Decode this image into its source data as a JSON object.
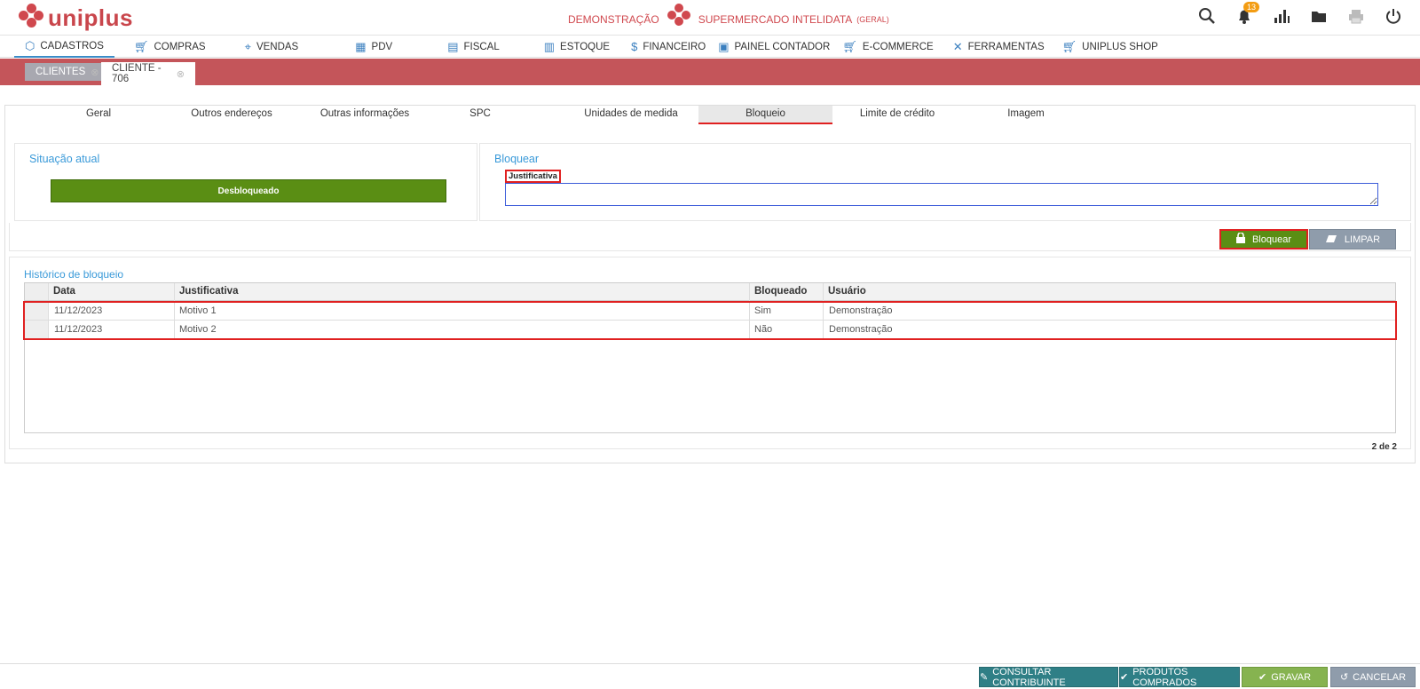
{
  "header": {
    "logo_text": "uniplus",
    "company_prefix": "DEMONSTRAÇÃO",
    "company_name": "SUPERMERCADO INTELIDATA",
    "company_scope": "(GERAL)",
    "notification_count": "13",
    "icons": [
      "search-icon",
      "bell-icon",
      "chart-icon",
      "folder-icon",
      "printer-icon",
      "power-icon"
    ]
  },
  "menu": [
    {
      "label": "CADASTROS",
      "icon": "hexagon-icon"
    },
    {
      "label": "COMPRAS",
      "icon": "cart-icon"
    },
    {
      "label": "VENDAS",
      "icon": "tag-icon"
    },
    {
      "label": "PDV",
      "icon": "register-icon"
    },
    {
      "label": "FISCAL",
      "icon": "document-icon"
    },
    {
      "label": "ESTOQUE",
      "icon": "box-icon"
    },
    {
      "label": "FINANCEIRO",
      "icon": "dollar-icon"
    },
    {
      "label": "PAINEL CONTADOR",
      "icon": "panel-icon"
    },
    {
      "label": "E-COMMERCE",
      "icon": "cart-icon"
    },
    {
      "label": "FERRAMENTAS",
      "icon": "tools-icon"
    },
    {
      "label": "UNIPLUS SHOP",
      "icon": "cart-icon"
    }
  ],
  "page_tabs": [
    {
      "label": "CLIENTES",
      "active": false
    },
    {
      "label": "CLIENTE - 706",
      "active": true
    }
  ],
  "sub_tabs": [
    {
      "label": "Geral"
    },
    {
      "label": "Outros endereços"
    },
    {
      "label": "Outras informações"
    },
    {
      "label": "SPC"
    },
    {
      "label": "Unidades de medida"
    },
    {
      "label": "Bloqueio",
      "active": true
    },
    {
      "label": "Limite de crédito"
    },
    {
      "label": "Imagem"
    }
  ],
  "situacao": {
    "title": "Situação atual",
    "status": "Desbloqueado",
    "status_color": "#5a8e14"
  },
  "bloquear": {
    "title": "Bloquear",
    "justificativa_label": "Justificativa",
    "justificativa_value": ""
  },
  "actions": {
    "bloquear_label": "Bloquear",
    "limpar_label": "LIMPAR"
  },
  "historico": {
    "title": "Histórico de bloqueio",
    "columns": [
      "Data",
      "Justificativa",
      "Bloqueado",
      "Usuário"
    ],
    "rows": [
      [
        "11/12/2023",
        "Motivo 1",
        "Sim",
        "Demonstração"
      ],
      [
        "11/12/2023",
        "Motivo 2",
        "Não",
        "Demonstração"
      ]
    ],
    "pager": "2 de 2"
  },
  "footer": {
    "consultar": "CONSULTAR CONTRIBUINTE",
    "produtos": "PRODUTOS COMPRADOS",
    "gravar": "GRAVAR",
    "cancelar": "CANCELAR"
  }
}
